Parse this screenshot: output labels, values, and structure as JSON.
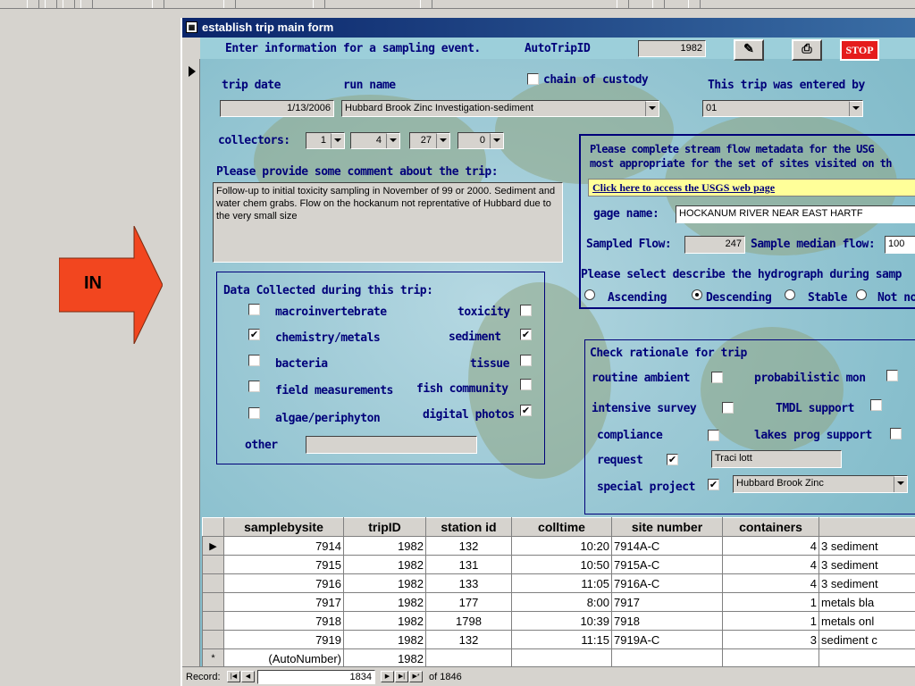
{
  "arrow": {
    "label": "IN",
    "color": "#f2461f"
  },
  "window": {
    "title": "establish trip main form",
    "header_text": "Enter information for a sampling event.",
    "autotrip_label": "AutoTripID",
    "autotrip_value": "1982",
    "stop_label": "STOP"
  },
  "trip": {
    "date_label": "trip date",
    "date_value": "1/13/2006",
    "run_label": "run name",
    "run_value": "Hubbard Brook Zinc Investigation-sediment",
    "custody_label": "chain of custody",
    "entered_label": "This trip was entered by",
    "entered_value": "01",
    "collectors_label": "collectors:",
    "collectors": [
      "1",
      "4",
      "27",
      "0"
    ],
    "comment_label": "Please provide some comment about the trip:",
    "comment_value": "Follow-up to initial toxicity sampling in November of 99 or 2000.  Sediment and water chem grabs. Flow on the hockanum not reprentative of Hubbard due to the very small size"
  },
  "data_collected": {
    "title": "Data Collected during this trip:",
    "left": [
      {
        "label": "macroinvertebrate",
        "checked": ""
      },
      {
        "label": "chemistry/metals",
        "checked": "✔"
      },
      {
        "label": "bacteria",
        "checked": ""
      },
      {
        "label": "field measurements",
        "checked": ""
      },
      {
        "label": "algae/periphyton",
        "checked": ""
      }
    ],
    "right": [
      {
        "label": "toxicity",
        "checked": ""
      },
      {
        "label": "sediment",
        "checked": "✔"
      },
      {
        "label": "tissue",
        "checked": ""
      },
      {
        "label": "fish community",
        "checked": ""
      },
      {
        "label": "digital photos",
        "checked": "✔"
      }
    ],
    "other_label": "other"
  },
  "flow": {
    "msg_line1": "Please complete stream flow metadata for the USG",
    "msg_line2": "most appropriate for the set of sites visited on th",
    "link_text": "Click here to access the USGS web page",
    "gage_label": "gage name:",
    "gage_value": "HOCKANUM RIVER NEAR EAST HARTF",
    "sampled_label": "Sampled Flow:",
    "sampled_value": "247",
    "median_label": "Sample median flow:",
    "median_value": "100",
    "hydro_label": "Please select describe the hydrograph during samp",
    "options": [
      "Ascending",
      "Descending",
      "Stable",
      "Not no"
    ]
  },
  "rationale": {
    "title": "Check rationale for trip",
    "routine": "routine ambient",
    "probabilistic": "probabilistic mon",
    "intensive": "intensive survey",
    "tmdl": "TMDL support",
    "compliance": "compliance",
    "lakes": "lakes prog support",
    "request": "request",
    "request_value": "Traci lott",
    "special": "special project",
    "special_value": "Hubbard Brook Zinc"
  },
  "grid": {
    "columns": [
      "samplebysite",
      "tripID",
      "station id",
      "colltime",
      "site number",
      "containers",
      ""
    ],
    "rows": [
      [
        "7914",
        "1982",
        "132",
        "10:20",
        "7914A-C",
        "4",
        "3 sediment"
      ],
      [
        "7915",
        "1982",
        "131",
        "10:50",
        "7915A-C",
        "4",
        "3 sediment"
      ],
      [
        "7916",
        "1982",
        "133",
        "11:05",
        "7916A-C",
        "4",
        "3 sediment"
      ],
      [
        "7917",
        "1982",
        "177",
        "8:00",
        "7917",
        "1",
        "metals bla"
      ],
      [
        "7918",
        "1982",
        "1798",
        "10:39",
        "7918",
        "1",
        "metals onl"
      ],
      [
        "7919",
        "1982",
        "132",
        "11:15",
        "7919A-C",
        "3",
        "sediment c"
      ]
    ],
    "new_row": [
      "(AutoNumber)",
      "1982"
    ],
    "new_row_marker": "*",
    "current_marker": "▶"
  },
  "nav": {
    "record_label": "Record:",
    "record_value": "1834",
    "of_text": "of  1846"
  }
}
